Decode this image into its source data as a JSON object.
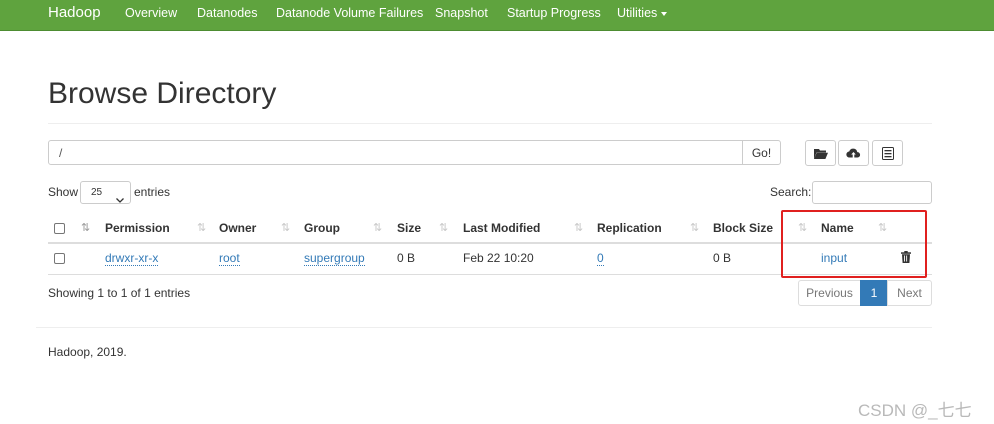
{
  "navbar": {
    "brand": "Hadoop",
    "items": [
      "Overview",
      "Datanodes",
      "Datanode Volume Failures",
      "Snapshot",
      "Startup Progress",
      "Utilities"
    ],
    "utilities_has_caret": true,
    "color": "#5fa33e"
  },
  "page": {
    "title": "Browse Directory"
  },
  "path_bar": {
    "value": "/",
    "go_label": "Go!"
  },
  "toolbar": {
    "icons": [
      "folder-open-icon",
      "cloud-upload-icon",
      "list-alt-icon"
    ]
  },
  "table_controls": {
    "show_label": "Show",
    "entries_value": "25",
    "entries_label": "entries",
    "search_label": "Search:",
    "search_value": ""
  },
  "table": {
    "columns": [
      "Permission",
      "Owner",
      "Group",
      "Size",
      "Last Modified",
      "Replication",
      "Block Size",
      "Name"
    ],
    "rows": [
      {
        "permission": "drwxr-xr-x",
        "owner": "root",
        "group": "supergroup",
        "size": "0 B",
        "last_modified": "Feb 22 10:20",
        "replication": "0",
        "block_size": "0 B",
        "name": "input"
      }
    ]
  },
  "pagination": {
    "info": "Showing 1 to 1 of 1 entries",
    "previous": "Previous",
    "current": "1",
    "next": "Next"
  },
  "footer": {
    "text": "Hadoop, 2019."
  },
  "watermark": "CSDN @_七七",
  "colors": {
    "link": "#337ab7",
    "highlight": "#e0201f",
    "pager_active": "#337ab7"
  }
}
